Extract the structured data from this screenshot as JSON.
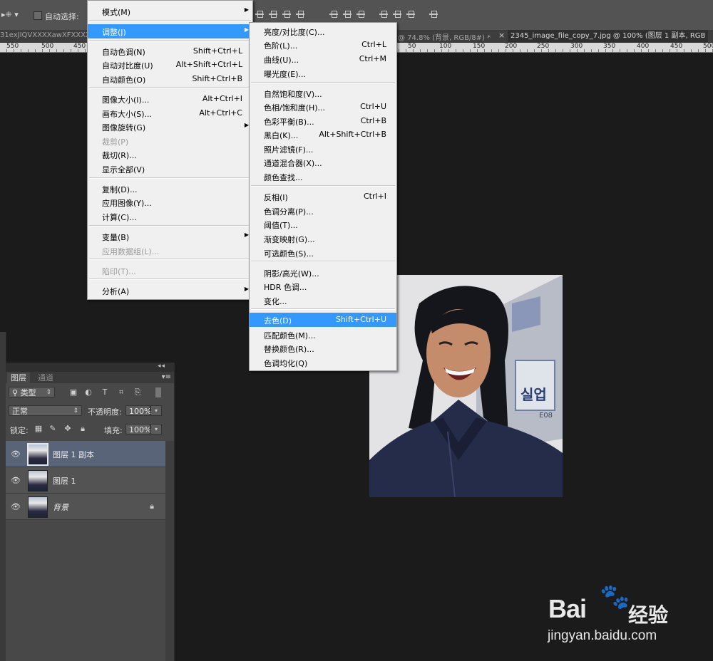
{
  "options_bar": {
    "tool_preset": "▸⁜ ▾",
    "auto_select_label": "自动选择:"
  },
  "document_tabs": [
    {
      "label": "31exJIQVXXXXawXFXXXXX",
      "active": false
    },
    {
      "label": "@ 74.8% (背景, RGB/8#) *",
      "active": false
    },
    {
      "label": "2345_image_file_copy_7.jpg @ 100% (图层 1 副本, RGB",
      "active": true
    }
  ],
  "tab_close": "×",
  "ruler_labels": [
    "550",
    "500",
    "450",
    "50",
    "100",
    "150",
    "200",
    "250",
    "300",
    "350",
    "400",
    "450",
    "500"
  ],
  "image_menu": {
    "items": [
      {
        "label": "模式(M)",
        "shortcut": "",
        "submenu": true,
        "disabled": false
      },
      {
        "label": "调整(J)",
        "shortcut": "",
        "submenu": true,
        "disabled": false,
        "highlighted": true
      },
      {
        "label": "自动色调(N)",
        "shortcut": "Shift+Ctrl+L"
      },
      {
        "label": "自动对比度(U)",
        "shortcut": "Alt+Shift+Ctrl+L"
      },
      {
        "label": "自动颜色(O)",
        "shortcut": "Shift+Ctrl+B"
      },
      {
        "label": "图像大小(I)...",
        "shortcut": "Alt+Ctrl+I"
      },
      {
        "label": "画布大小(S)...",
        "shortcut": "Alt+Ctrl+C"
      },
      {
        "label": "图像旋转(G)",
        "shortcut": "",
        "submenu": true
      },
      {
        "label": "裁剪(P)",
        "shortcut": "",
        "disabled": true
      },
      {
        "label": "裁切(R)...",
        "shortcut": ""
      },
      {
        "label": "显示全部(V)",
        "shortcut": ""
      },
      {
        "label": "复制(D)...",
        "shortcut": ""
      },
      {
        "label": "应用图像(Y)...",
        "shortcut": ""
      },
      {
        "label": "计算(C)...",
        "shortcut": ""
      },
      {
        "label": "变量(B)",
        "shortcut": "",
        "submenu": true
      },
      {
        "label": "应用数据组(L)...",
        "shortcut": "",
        "disabled": true
      },
      {
        "label": "陷印(T)...",
        "shortcut": "",
        "disabled": true
      },
      {
        "label": "分析(A)",
        "shortcut": "",
        "submenu": true
      }
    ]
  },
  "adjust_menu": {
    "items": [
      {
        "label": "亮度/对比度(C)...",
        "shortcut": ""
      },
      {
        "label": "色阶(L)...",
        "shortcut": "Ctrl+L"
      },
      {
        "label": "曲线(U)...",
        "shortcut": "Ctrl+M"
      },
      {
        "label": "曝光度(E)...",
        "shortcut": ""
      },
      {
        "label": "自然饱和度(V)...",
        "shortcut": ""
      },
      {
        "label": "色相/饱和度(H)...",
        "shortcut": "Ctrl+U"
      },
      {
        "label": "色彩平衡(B)...",
        "shortcut": "Ctrl+B"
      },
      {
        "label": "黑白(K)...",
        "shortcut": "Alt+Shift+Ctrl+B"
      },
      {
        "label": "照片滤镜(F)...",
        "shortcut": ""
      },
      {
        "label": "通道混合器(X)...",
        "shortcut": ""
      },
      {
        "label": "颜色查找...",
        "shortcut": ""
      },
      {
        "label": "反相(I)",
        "shortcut": "Ctrl+I"
      },
      {
        "label": "色调分离(P)...",
        "shortcut": ""
      },
      {
        "label": "阈值(T)...",
        "shortcut": ""
      },
      {
        "label": "渐变映射(G)...",
        "shortcut": ""
      },
      {
        "label": "可选颜色(S)...",
        "shortcut": ""
      },
      {
        "label": "阴影/高光(W)...",
        "shortcut": ""
      },
      {
        "label": "HDR 色调...",
        "shortcut": ""
      },
      {
        "label": "变化...",
        "shortcut": ""
      },
      {
        "label": "去色(D)",
        "shortcut": "Shift+Ctrl+U",
        "highlighted": true
      },
      {
        "label": "匹配颜色(M)...",
        "shortcut": ""
      },
      {
        "label": "替换颜色(R)...",
        "shortcut": ""
      },
      {
        "label": "色调均化(Q)",
        "shortcut": ""
      }
    ]
  },
  "layers_panel": {
    "collapse": "◂◂",
    "close": "×",
    "tabs": [
      "图层",
      "通道"
    ],
    "menu_icon": "▾≡",
    "filter_kind": "类型",
    "blend_mode": "正常",
    "opacity_label": "不透明度:",
    "opacity_value": "100%",
    "lock_label": "锁定:",
    "fill_label": "填充:",
    "fill_value": "100%",
    "layers": [
      {
        "name": "图层 1 副本",
        "selected": true,
        "locked": false
      },
      {
        "name": "图层 1",
        "selected": false,
        "locked": false
      },
      {
        "name": "背景",
        "selected": false,
        "locked": true
      }
    ]
  },
  "photo": {
    "sign_text": "실업",
    "sign_text_2": "E08"
  },
  "watermark": {
    "brand": "Bai",
    "paw": "🐾",
    "jingyan": "经验",
    "url": "jingyan.baidu.com"
  },
  "colors": {
    "menu_highlight": "#3399ff",
    "selected_layer": "#596479",
    "app_bg": "#1b1b1b"
  }
}
